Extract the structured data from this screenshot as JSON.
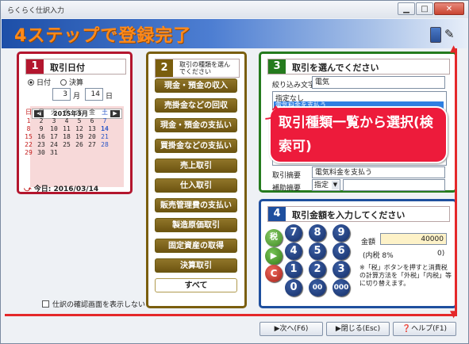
{
  "window": {
    "title": "らくらく仕訳入力"
  },
  "banner": {
    "text": "4ステップで登録完了"
  },
  "colors": {
    "step1": "#b3162e",
    "step2": "#7a5e0e",
    "step3": "#257b1e",
    "step4": "#1e4f9e",
    "annotation": "#e4282a"
  },
  "step1": {
    "number": "1",
    "title": "取引日付",
    "radio_date": "日付",
    "radio_settlement": "決算",
    "month": "3",
    "month_unit": "月",
    "day": "14",
    "day_unit": "日",
    "calendar_title": "2015年3月",
    "weekdays": [
      "日",
      "月",
      "火",
      "水",
      "木",
      "金",
      "土"
    ],
    "today_label": "今日: 2016/03/14"
  },
  "step2": {
    "number": "2",
    "title": "取引の種類を選んでください",
    "buttons": [
      "現金・預金の収入",
      "売掛金などの回収",
      "現金・預金の支払い",
      "買掛金などの支払い",
      "売上取引",
      "仕入取引",
      "販売管理費の支払い",
      "製造原価取引",
      "固定資産の取得",
      "決算取引"
    ],
    "all_label": "すべて"
  },
  "step3": {
    "number": "3",
    "title": "取引を選んでください",
    "filter_label": "絞り込み文字",
    "filter_value": "電気",
    "list_items": [
      "指定なし",
      "電気料金を支払う"
    ],
    "summary_label": "取引摘要",
    "summary_value": "電気料金を支払う",
    "aux_label": "補助摘要",
    "aux_value": "指定"
  },
  "step4": {
    "number": "4",
    "title": "取引金額を入力してください",
    "keys": {
      "tax": "税",
      "clear": "C",
      "k7": "7",
      "k8": "8",
      "k9": "9",
      "k4": "4",
      "k5": "5",
      "k6": "6",
      "k1": "1",
      "k2": "2",
      "k3": "3",
      "k0": "0",
      "k00": "00",
      "k000": "000"
    },
    "amount_label": "金額",
    "amount_value": "40000",
    "tax_info": "(内税 8%",
    "tax_amount": "0)",
    "note": "※「税」ボタンを押すと消費税の計算方法を「外税」「内税」等に切り替えます。"
  },
  "annotation": {
    "text": "取引種類一覧から選択(検索可)"
  },
  "footer": {
    "confirm_label": "仕訳の確認画面を表示しない",
    "next_label": "次へ(F6)",
    "close_label": "閉じる(Esc)",
    "help_label": "ヘルプ(F1)"
  }
}
